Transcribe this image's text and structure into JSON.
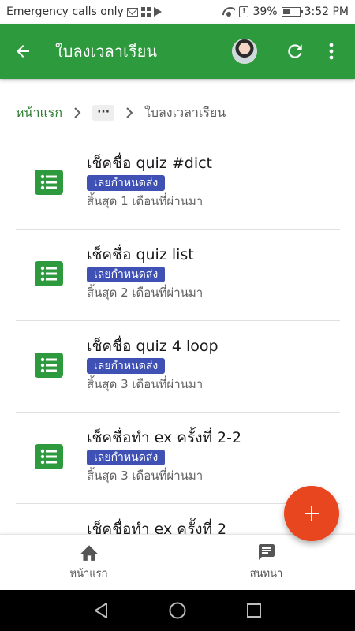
{
  "status_bar": {
    "carrier_text": "Emergency calls only",
    "battery": "39%",
    "time": "3:52 PM",
    "icons": [
      "mail-icon",
      "grid-icon",
      "play-store-icon",
      "wifi-icon",
      "alert-icon",
      "battery-icon"
    ]
  },
  "app_bar": {
    "title": "ใบลงเวลาเรียน",
    "back_icon": "arrow-back-icon",
    "refresh_icon": "refresh-icon",
    "more_icon": "more-vert-icon",
    "color": "#2e9a3e"
  },
  "breadcrumb": {
    "home": "หน้าแรก",
    "ellipsis": "···",
    "current": "ใบลงเวลาเรียน"
  },
  "items": [
    {
      "title": "เช็คชื่อ quiz #dict",
      "badge": "เลยกำหนดส่ง",
      "subtitle": "สิ้นสุด 1 เดือนที่ผ่านมา"
    },
    {
      "title": "เช็คชื่อ quiz list",
      "badge": "เลยกำหนดส่ง",
      "subtitle": "สิ้นสุด 2 เดือนที่ผ่านมา"
    },
    {
      "title": "เช็คชื่อ quiz 4 loop",
      "badge": "เลยกำหนดส่ง",
      "subtitle": "สิ้นสุด 3 เดือนที่ผ่านมา"
    },
    {
      "title": "เช็คชื่อทำ ex ครั้งที่ 2-2",
      "badge": "เลยกำหนดส่ง",
      "subtitle": "สิ้นสุด 3 เดือนที่ผ่านมา"
    },
    {
      "title": "เช็คชื่อทำ ex ครั้งที่ 2",
      "badge": "",
      "subtitle": ""
    }
  ],
  "fab": {
    "icon": "plus-icon",
    "color": "#e8461e"
  },
  "bottom_nav": {
    "home_label": "หน้าแรก",
    "chat_label": "สนทนา"
  },
  "colors": {
    "badge": "#3f51b5",
    "accent": "#2e7d32"
  }
}
